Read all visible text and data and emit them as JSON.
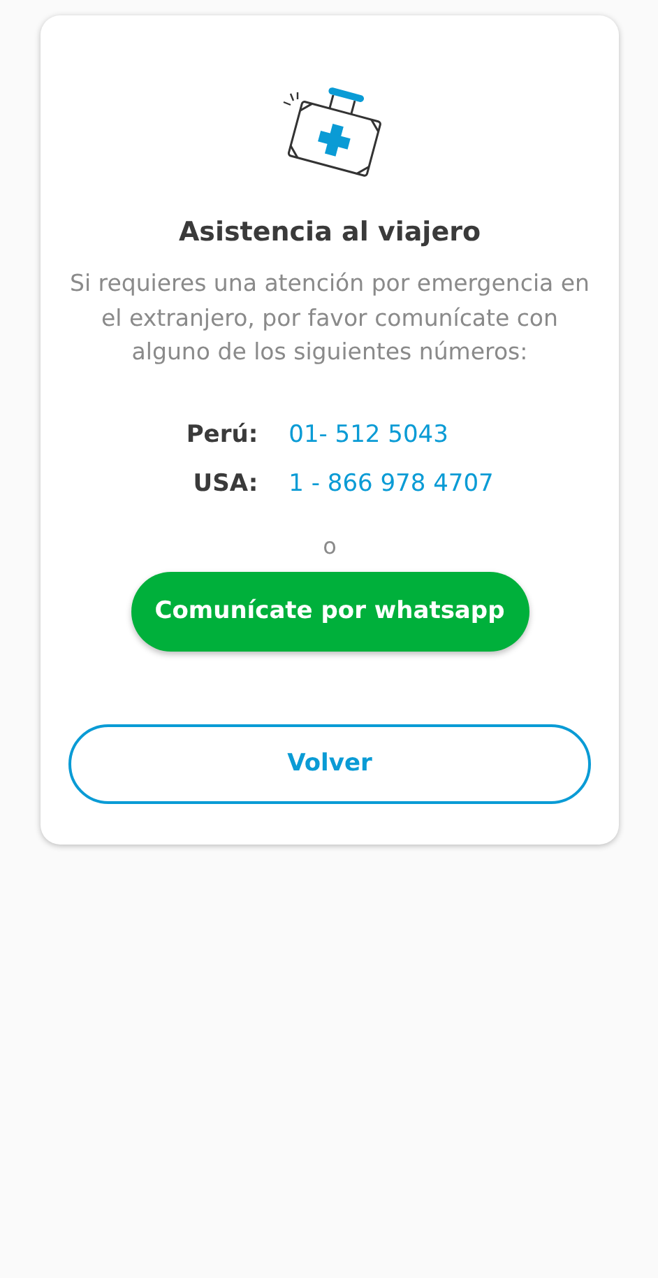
{
  "title": "Asistencia al viajero",
  "message": "Si requieres una atención por emergencia en el extranjero, por favor comunícate con alguno de los siguientes números:",
  "phones": [
    {
      "country": "Perú:",
      "number": "01- 512 5043"
    },
    {
      "country": "USA:",
      "number": "1 - 866 978 4707"
    }
  ],
  "separator": "o",
  "whatsapp_button": "Comunícate por whatsapp",
  "back_button": "Volver"
}
